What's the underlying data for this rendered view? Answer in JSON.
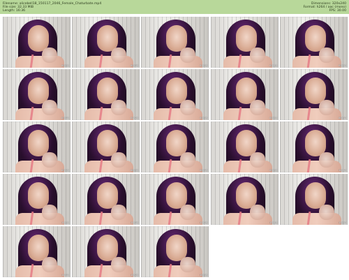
{
  "header": {
    "filename_line": "Filename: alicebell18_150117_2046_Female_Chaturbate.mp4",
    "filesize_line": "File size: 32.33 MiB",
    "length_line": "Length: 16:36",
    "dimensions_line": "Dimensions: 320x240",
    "format_line": "Format: h264 / aac (mono)",
    "fps_line": "FPS: 30.00"
  },
  "thumbnails": [
    {
      "time": "00:01"
    },
    {
      "time": "00:45"
    },
    {
      "time": "01:29"
    },
    {
      "time": "02:13"
    },
    {
      "time": "02:57"
    },
    {
      "time": "03:41"
    },
    {
      "time": "04:25"
    },
    {
      "time": "05:09"
    },
    {
      "time": "05:53"
    },
    {
      "time": "06:37"
    },
    {
      "time": "07:21"
    },
    {
      "time": "08:05"
    },
    {
      "time": "08:49"
    },
    {
      "time": "09:33"
    },
    {
      "time": "10:17"
    },
    {
      "time": "11:01"
    },
    {
      "time": "11:45"
    },
    {
      "time": "12:29"
    },
    {
      "time": "13:13"
    },
    {
      "time": "13:57"
    },
    {
      "time": "14:41"
    },
    {
      "time": "15:25"
    },
    {
      "time": "16:09"
    }
  ]
}
